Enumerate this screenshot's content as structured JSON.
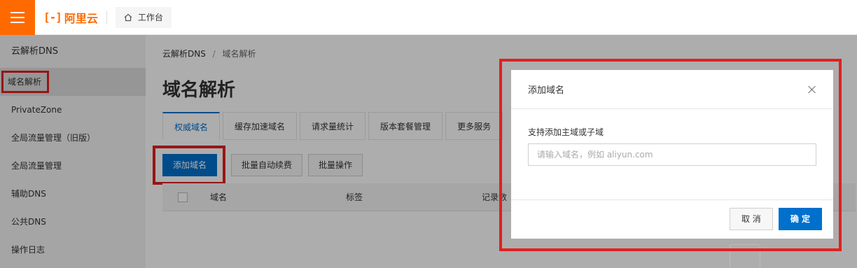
{
  "topbar": {
    "logo_mark": "[-]",
    "logo_text": "阿里云",
    "workbench_label": "工作台"
  },
  "sidebar": {
    "title": "云解析DNS",
    "items": [
      {
        "label": "域名解析"
      },
      {
        "label": "PrivateZone"
      },
      {
        "label": "全局流量管理（旧版）"
      },
      {
        "label": "全局流量管理"
      },
      {
        "label": "辅助DNS"
      },
      {
        "label": "公共DNS"
      },
      {
        "label": "操作日志"
      }
    ]
  },
  "breadcrumb": {
    "root": "云解析DNS",
    "sep": "/",
    "current": "域名解析"
  },
  "page_title": "域名解析",
  "tabs": [
    {
      "label": "权威域名"
    },
    {
      "label": "缓存加速域名"
    },
    {
      "label": "请求量统计"
    },
    {
      "label": "版本套餐管理"
    },
    {
      "label": "更多服务"
    }
  ],
  "actions": {
    "add_domain": "添加域名",
    "batch_renew": "批量自动续费",
    "batch_ops": "批量操作"
  },
  "table": {
    "headers": [
      "域名",
      "标签",
      "记录数"
    ]
  },
  "dialog": {
    "title": "添加域名",
    "field_label": "支持添加主域或子域",
    "placeholder": "请输入域名，例如 aliyun.com",
    "value": "",
    "cancel": "取 消",
    "confirm": "确 定"
  },
  "colors": {
    "brand": "#ff6a00",
    "primary": "#0070cc",
    "highlight": "#e02020"
  }
}
